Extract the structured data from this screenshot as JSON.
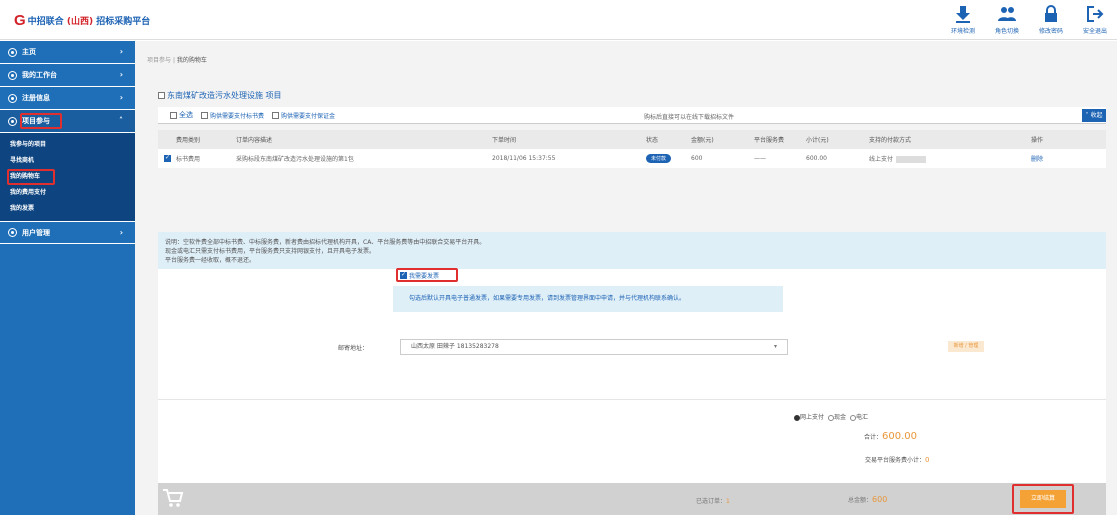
{
  "header": {
    "logo_letter": "G",
    "logo_brand": "中招联合",
    "logo_region": "(山西)",
    "logo_platform": "招标采购平台",
    "tools": [
      {
        "label": "环境检测",
        "icon": "download-icon"
      },
      {
        "label": "角色切换",
        "icon": "users-icon"
      },
      {
        "label": "修改密码",
        "icon": "lock-icon"
      },
      {
        "label": "安全退出",
        "icon": "logout-icon"
      }
    ]
  },
  "sidebar": {
    "items": [
      {
        "label": "主页"
      },
      {
        "label": "我的工作台"
      },
      {
        "label": "注册信息"
      },
      {
        "label": "项目参与"
      },
      {
        "label": "用户管理"
      }
    ],
    "sub_items": [
      {
        "label": "我参与的项目"
      },
      {
        "label": "寻找商机"
      },
      {
        "label": "我的购物车"
      },
      {
        "label": "我的费用支付"
      },
      {
        "label": "我的发票"
      }
    ]
  },
  "breadcrumb": {
    "parent": "项目参与",
    "separator": "|",
    "current": "我的购物车"
  },
  "project": {
    "title": "东南煤矿改造污水处理设施 项目"
  },
  "select_row": {
    "select_all": "全选",
    "opt1": "购供需要支付标书费",
    "opt2": "购供需要支付保证金",
    "note": "购标后直接可以在线下载招标文件",
    "collapse": "收起"
  },
  "table": {
    "headers": [
      "费用类别",
      "订单内容描述",
      "下单时间",
      "状态",
      "金额(元)",
      "平台服务费",
      "小计(元)",
      "支持的付款方式",
      "操作"
    ],
    "rows": [
      {
        "category": "标书费用",
        "description": "采购标段东南煤矿改造污水处理设施的第1包",
        "time": "2018/11/06 15:37:55",
        "status": "未付款",
        "amount": "600",
        "service_fee": "——",
        "subtotal": "600.00",
        "payment": "线上支付",
        "action": "删除"
      }
    ]
  },
  "notice": {
    "lines": [
      "说明：空软件费全部中标书费、中标服务费，新者费由招标代理机构开具，CA、平台服务费等由中招联合交易平台开具。",
      "现金或电汇只需支付标书费用，平台服务费只支持网银支付，且开具电子发票。",
      "平台服务费一经收取，概不退还。"
    ]
  },
  "invoice": {
    "check_label": "我需要发票",
    "tip": "勾选后默认开具电子普通发票，如果需要专用发票，请到发票管理界面中申请，并与代理机构联系确认。",
    "address_label": "邮寄地址：",
    "address_value": "山西太原 田辣子 18135283278",
    "address_btn": "新增 / 管理"
  },
  "payment": {
    "options": [
      "网上支付",
      "现金",
      "电汇"
    ],
    "total_label": "合计：",
    "total_value": "600.00",
    "service_label": "交易平台服务费小计：",
    "service_value": "0"
  },
  "footer": {
    "selected_label": "已选订单：",
    "selected_value": "1",
    "sum_label": "总金额：",
    "sum_value": "600",
    "submit": "立即结算"
  }
}
